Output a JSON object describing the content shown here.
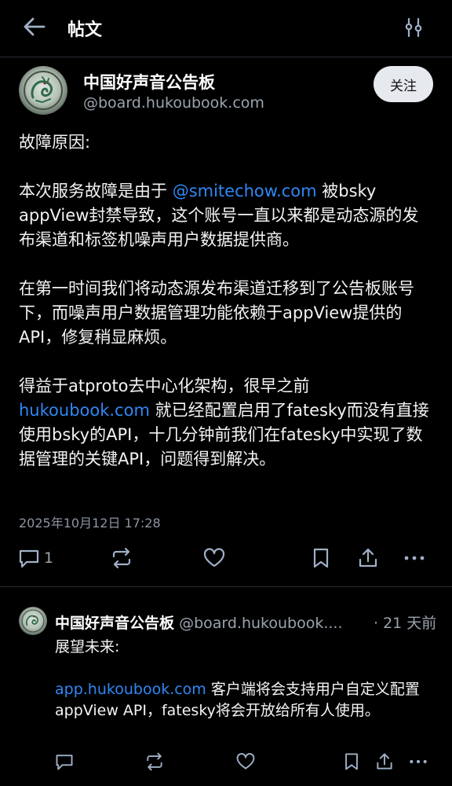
{
  "header": {
    "title": "帖文",
    "back_icon": "arrow-left-icon",
    "filter_icon": "sliders-icon"
  },
  "post": {
    "author_name": "中国好声音公告板",
    "author_handle": "@board.hukoubook.com",
    "follow_label": "关注",
    "paragraphs": {
      "p1": "故障原因:",
      "p2_pre": "本次服务故障是由于 ",
      "p2_link": "@smitechow.com",
      "p2_post": " 被bsky appView封禁导致，这个账号一直以来都是动态源的发布渠道和标签机噪声用户数据提供商。",
      "p3": "在第一时间我们将动态源发布渠道迁移到了公告板账号下，而噪声用户数据管理功能依赖于appView提供的API，修复稍显麻烦。",
      "p4_pre": "得益于atproto去中心化架构，很早之前",
      "p4_link": "hukoubook.com",
      "p4_post": " 就已经配置启用了fatesky而没有直接使用bsky的API，十几分钟前我们在fatesky中实现了数据管理的关键API，问题得到解决。"
    },
    "date": "2025年10月12日 17:28",
    "reply_count": "1"
  },
  "reply": {
    "author_name": "中国好声音公告板",
    "author_handle": "@board.hukoubook....",
    "time": "· 21 天前",
    "p1": "展望未来:",
    "p2_link": "app.hukoubook.com",
    "p2_post": " 客户端将会支持用户自定义配置appView API，fatesky将会开放给所有人使用。"
  },
  "colors": {
    "background": "#000000",
    "link": "#2f87f5",
    "muted": "#9aa3ae",
    "follow_button_bg": "#e6e9ee"
  }
}
